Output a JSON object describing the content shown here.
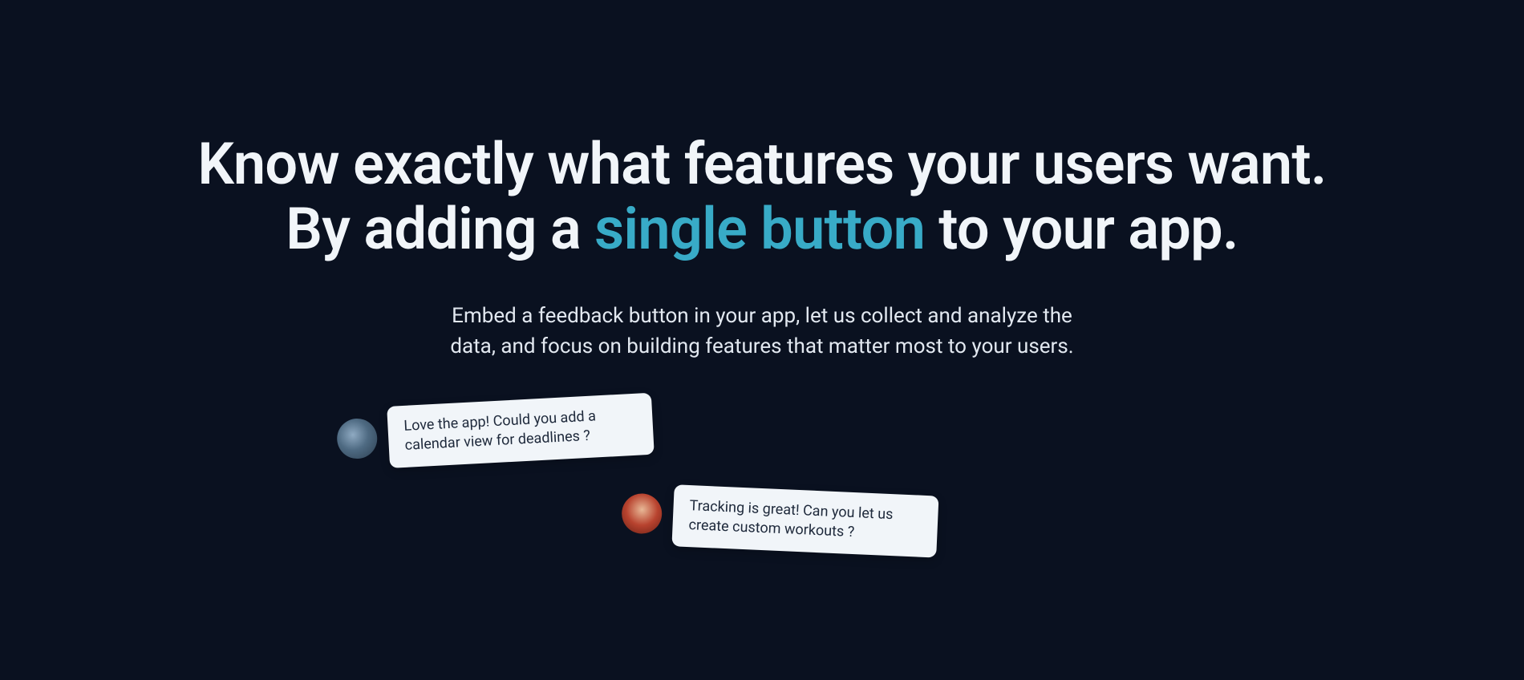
{
  "hero": {
    "headline_prefix": "Know exactly what features your users want.\nBy adding a ",
    "headline_highlight": "single button",
    "headline_suffix": " to your app.",
    "subheadline": "Embed a feedback button in your app, let us collect and analyze the data, and focus on building features that matter most to your users."
  },
  "feedback": {
    "items": [
      {
        "text": "Love the app! Could you add a calendar view for deadlines ?"
      },
      {
        "text": "Tracking is great! Can you let us create custom workouts ?"
      }
    ]
  }
}
